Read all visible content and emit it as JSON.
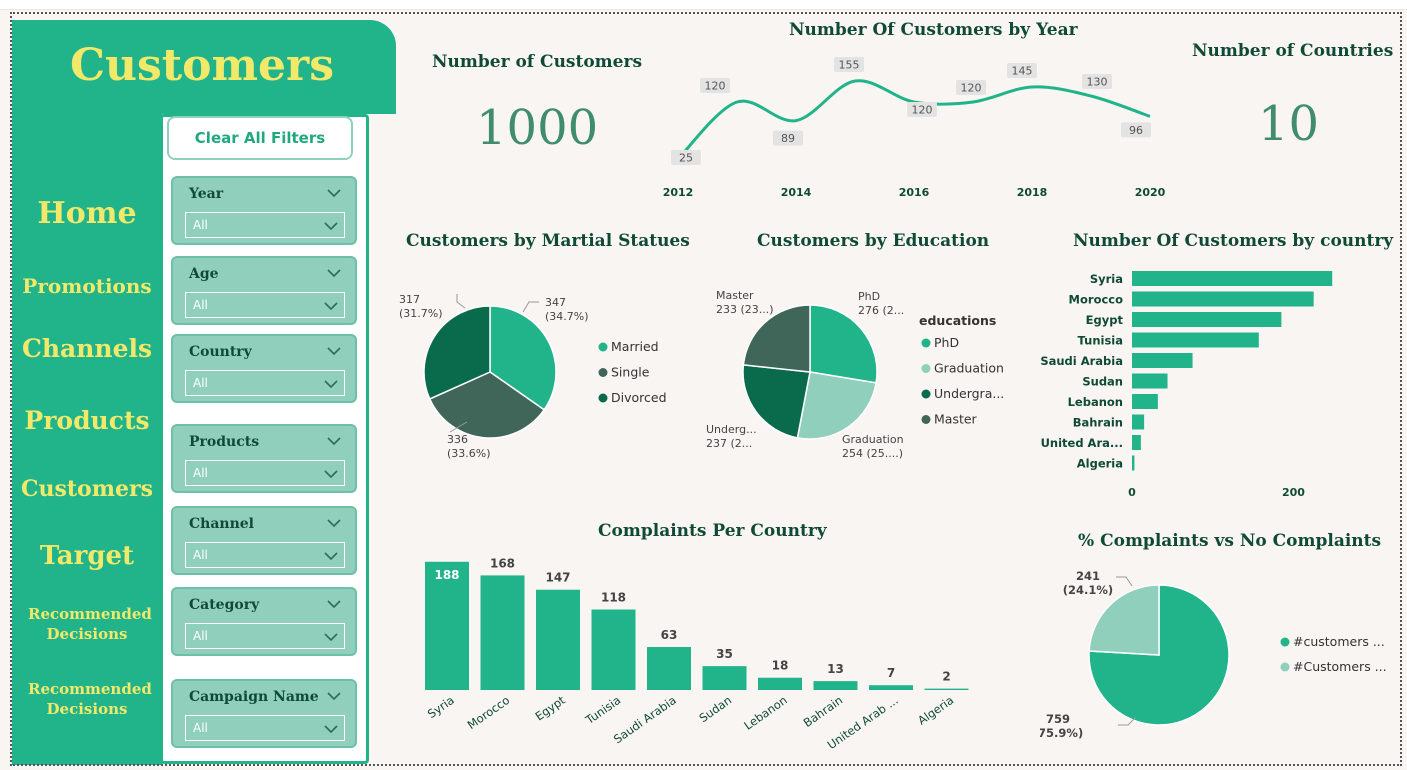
{
  "colors": {
    "accent": "#21b38a",
    "dark": "#104a37",
    "yellow": "#f2e96b",
    "light": "#8fcfbb",
    "darkgreen": "#0a6b4c",
    "slate": "#3f6659"
  },
  "app": {
    "title": "Customers"
  },
  "nav": {
    "items": [
      "Home",
      "Promotions",
      "Channels",
      "Products",
      "Customers",
      "Target",
      "Recommended Decisions",
      "Recommended Decisions"
    ]
  },
  "filters": {
    "clear_label": "Clear All Filters",
    "slicers": [
      {
        "label": "Year",
        "value": "All"
      },
      {
        "label": "Age",
        "value": "All"
      },
      {
        "label": "Country",
        "value": "All"
      },
      {
        "label": "Products",
        "value": "All"
      },
      {
        "label": "Channel",
        "value": "All"
      },
      {
        "label": "Category",
        "value": "All"
      },
      {
        "label": "Campaign Name",
        "value": "All"
      }
    ]
  },
  "kpis": {
    "customers": {
      "label": "Number of Customers",
      "value": "1000"
    },
    "countries": {
      "label": "Number of Countries",
      "value": "10"
    }
  },
  "charts": {
    "by_year": {
      "title": "Number Of Customers by Year"
    },
    "marital": {
      "title": "Customers by Martial Statues"
    },
    "education": {
      "title": "Customers by Education",
      "legend_title": "educations"
    },
    "country": {
      "title": "Number Of Customers by country"
    },
    "complaints": {
      "title": "Complaints Per Country"
    },
    "pct_complaints": {
      "title": "% Complaints vs No Complaints"
    }
  },
  "chart_data": [
    {
      "type": "line",
      "title": "Number Of Customers by Year",
      "x": [
        2012,
        2013,
        2014,
        2015,
        2016,
        2017,
        2018,
        2019,
        2020
      ],
      "values": [
        25,
        120,
        89,
        155,
        120,
        120,
        145,
        130,
        96
      ],
      "xticks": [
        "2012",
        "2014",
        "2016",
        "2018",
        "2020"
      ],
      "ylim": [
        0,
        170
      ]
    },
    {
      "type": "pie",
      "title": "Customers by Martial Statues",
      "labels": [
        "Married",
        "Single",
        "Divorced"
      ],
      "values": [
        347,
        336,
        317
      ],
      "data_labels": [
        "347\n(34.7%)",
        "336\n(33.6%)",
        "317\n(31.7%)"
      ]
    },
    {
      "type": "pie",
      "title": "Customers by Education",
      "legend_title": "educations",
      "labels": [
        "PhD",
        "Graduation",
        "Undergra...",
        "Master"
      ],
      "values": [
        276,
        254,
        237,
        233
      ],
      "data_labels": [
        "PhD\n276 (2...",
        "Graduation\n254 (25....)",
        "Underg...\n237 (2...",
        "Master\n233 (23...)"
      ]
    },
    {
      "type": "bar",
      "orientation": "horizontal",
      "title": "Number Of Customers by country",
      "categories": [
        "Syria",
        "Morocco",
        "Egypt",
        "Tunisia",
        "Saudi Arabia",
        "Sudan",
        "Lebanon",
        "Bahrain",
        "United Ara...",
        "Algeria"
      ],
      "values": [
        248,
        225,
        185,
        157,
        75,
        44,
        32,
        15,
        11,
        3
      ],
      "xticks": [
        "0",
        "200"
      ],
      "xlim": [
        0,
        270
      ]
    },
    {
      "type": "bar",
      "title": "Complaints Per Country",
      "categories": [
        "Syria",
        "Morocco",
        "Egypt",
        "Tunisia",
        "Saudi Arabia",
        "Sudan",
        "Lebanon",
        "Bahrain",
        "United Arab ...",
        "Algeria"
      ],
      "values": [
        188,
        168,
        147,
        118,
        63,
        35,
        18,
        13,
        7,
        2
      ],
      "ylim": [
        0,
        195
      ]
    },
    {
      "type": "pie",
      "title": "% Complaints vs No Complaints",
      "labels": [
        "#customers ...",
        "#Customers ..."
      ],
      "values": [
        759,
        241
      ],
      "data_labels": [
        "759\n(75.9%)",
        "241\n(24.1%)"
      ]
    }
  ]
}
